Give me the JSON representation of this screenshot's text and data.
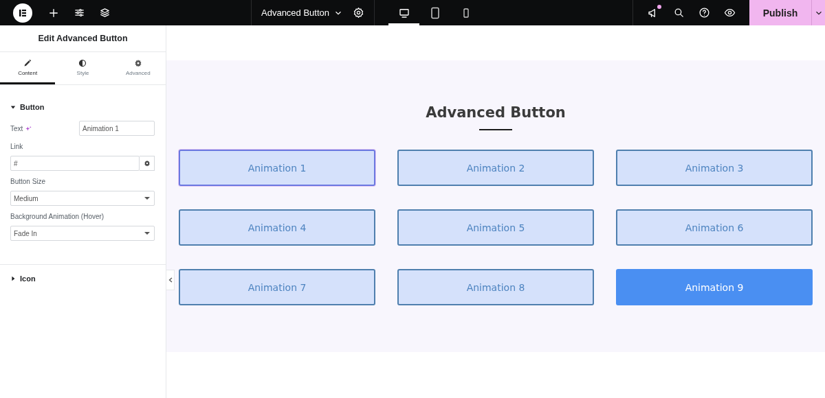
{
  "top_bar": {
    "document_title": "Advanced Button",
    "devices": [
      {
        "kind": "desktop",
        "selected": true
      },
      {
        "kind": "tablet",
        "selected": false
      },
      {
        "kind": "mobile",
        "selected": false
      }
    ],
    "notification_dot": true,
    "publish_label": "Publish"
  },
  "panel": {
    "title": "Edit Advanced Button",
    "tabs": [
      {
        "label": "Content",
        "selected": true
      },
      {
        "label": "Style",
        "selected": false
      },
      {
        "label": "Advanced",
        "selected": false
      }
    ],
    "sections": [
      {
        "title": "Button",
        "expanded": true
      },
      {
        "title": "Icon",
        "expanded": false
      }
    ],
    "fields": [
      {
        "kind": "inline",
        "label": "Text",
        "value": "Animation 1"
      },
      {
        "kind": "link",
        "label": "Link",
        "value": "#"
      },
      {
        "kind": "select",
        "label": "Button Size",
        "value": "Medium"
      },
      {
        "kind": "select",
        "label": "Background Animation (Hover)",
        "value": "Fade In"
      }
    ]
  },
  "canvas": {
    "heading": "Advanced Button",
    "buttons": [
      {
        "label": "Animation 1",
        "selected": true,
        "hovered": false
      },
      {
        "label": "Animation 2",
        "selected": false,
        "hovered": false
      },
      {
        "label": "Animation 3",
        "selected": false,
        "hovered": false
      },
      {
        "label": "Animation 4",
        "selected": false,
        "hovered": false
      },
      {
        "label": "Animation 5",
        "selected": false,
        "hovered": false
      },
      {
        "label": "Animation 6",
        "selected": false,
        "hovered": false
      },
      {
        "label": "Animation 7",
        "selected": false,
        "hovered": false
      },
      {
        "label": "Animation 8",
        "selected": false,
        "hovered": false
      },
      {
        "label": "Animation 9",
        "selected": false,
        "hovered": true
      }
    ]
  }
}
